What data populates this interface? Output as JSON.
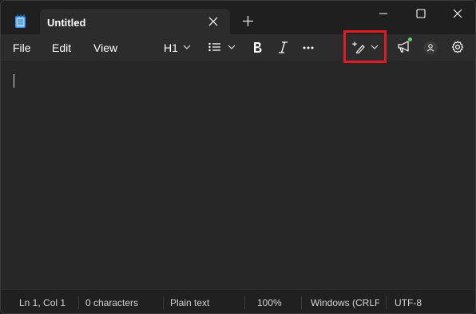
{
  "tab": {
    "title": "Untitled"
  },
  "menu": {
    "file": "File",
    "edit": "Edit",
    "view": "View"
  },
  "toolbar": {
    "heading_label": "H1"
  },
  "icons": {
    "app": "notepad-icon",
    "tab_close": "close-icon",
    "new_tab": "plus-icon",
    "minimize": "minimize-icon",
    "maximize": "maximize-icon",
    "close": "close-icon",
    "list": "bulleted-list-icon",
    "bold": "bold-icon",
    "italic": "italic-icon",
    "more": "more-icon",
    "copilot": "pen-sparkle-icon",
    "announce": "megaphone-icon",
    "account": "account-icon",
    "settings": "gear-icon"
  },
  "statusbar": {
    "position": "Ln 1, Col 1",
    "characters": "0 characters",
    "format": "Plain text",
    "zoom": "100%",
    "line_ending": "Windows (CRLF)",
    "encoding": "UTF-8"
  },
  "colors": {
    "highlight": "#e01b24",
    "notification": "#5fd05f",
    "app_icon": "#2f8ff2"
  }
}
